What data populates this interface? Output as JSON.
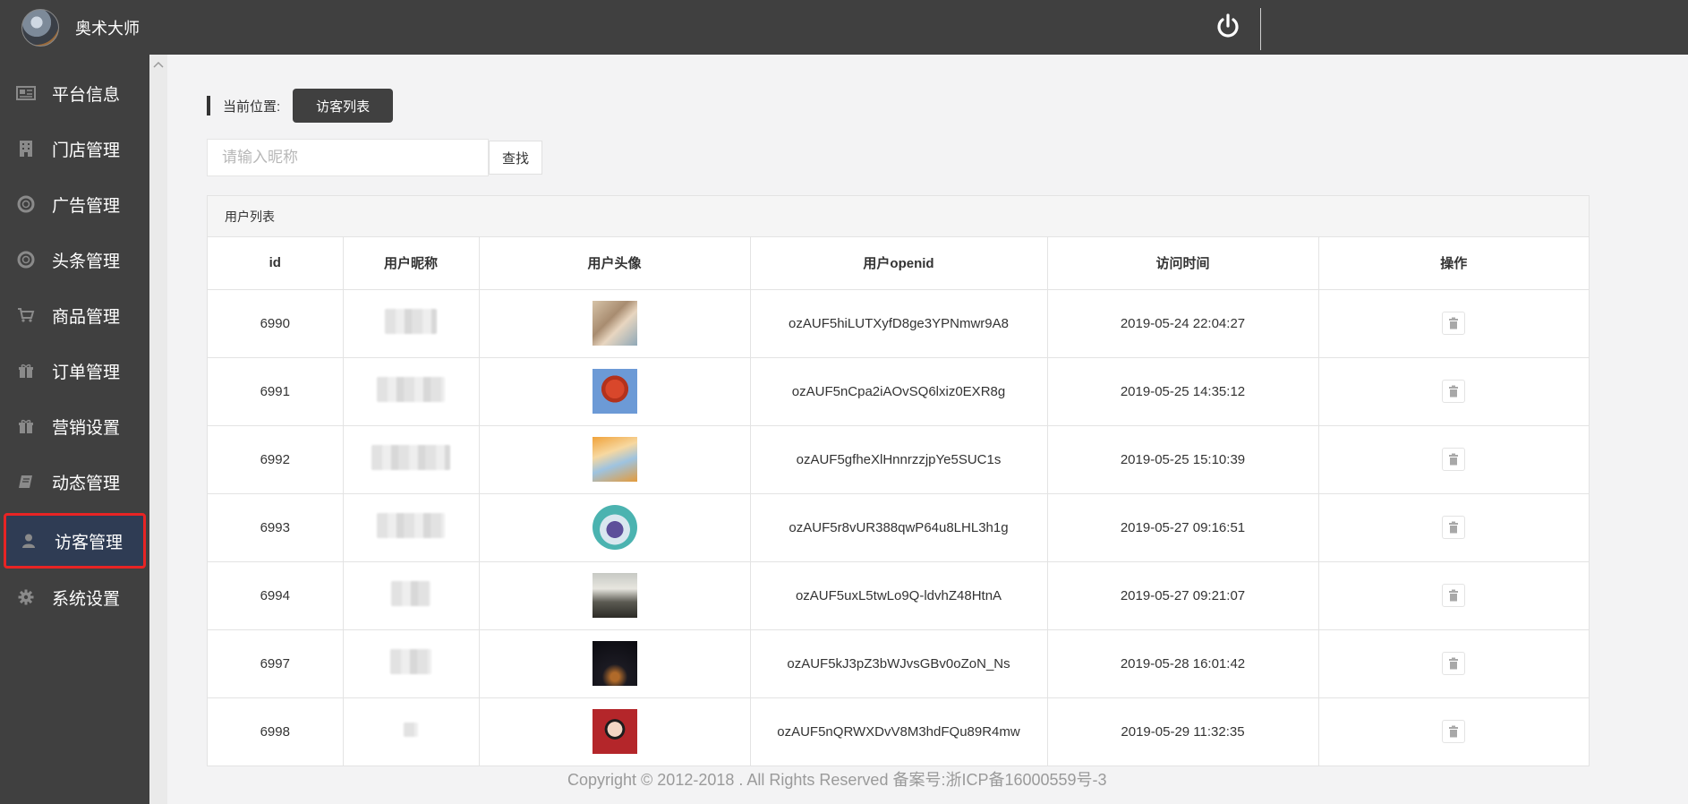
{
  "header": {
    "brand_name": "奥术大师",
    "icons": {
      "avatar": "user-avatar",
      "power": "power-icon"
    }
  },
  "sidebar": {
    "items": [
      {
        "label": "平台信息",
        "icon": "newspaper-icon"
      },
      {
        "label": "门店管理",
        "icon": "building-icon"
      },
      {
        "label": "广告管理",
        "icon": "lifebuoy-icon"
      },
      {
        "label": "头条管理",
        "icon": "lifebuoy-icon"
      },
      {
        "label": "商品管理",
        "icon": "cart-icon"
      },
      {
        "label": "订单管理",
        "icon": "gift-icon"
      },
      {
        "label": "营销设置",
        "icon": "gift-icon"
      },
      {
        "label": "动态管理",
        "icon": "book-icon"
      },
      {
        "label": "访客管理",
        "icon": "user-icon",
        "active": true
      },
      {
        "label": "系统设置",
        "icon": "gear-icon"
      }
    ]
  },
  "breadcrumb": {
    "label": "当前位置:",
    "current": "访客列表"
  },
  "search": {
    "placeholder": "请输入昵称",
    "value": "",
    "button": "查找"
  },
  "panel": {
    "title": "用户列表",
    "columns": [
      "id",
      "用户昵称",
      "用户头像",
      "用户openid",
      "访问时间",
      "操作"
    ],
    "rows": [
      {
        "id": "6990",
        "openid": "ozAUF5hiLUTXyfD8ge3YPNmwr9A8",
        "time": "2019-05-24 22:04:27"
      },
      {
        "id": "6991",
        "openid": "ozAUF5nCpa2iAOvSQ6lxiz0EXR8g",
        "time": "2019-05-25 14:35:12"
      },
      {
        "id": "6992",
        "openid": "ozAUF5gfheXlHnnrzzjpYe5SUC1s",
        "time": "2019-05-25 15:10:39"
      },
      {
        "id": "6993",
        "openid": "ozAUF5r8vUR388qwP64u8LHL3h1g",
        "time": "2019-05-27 09:16:51"
      },
      {
        "id": "6994",
        "openid": "ozAUF5uxL5twLo9Q-ldvhZ48HtnA",
        "time": "2019-05-27 09:21:07"
      },
      {
        "id": "6997",
        "openid": "ozAUF5kJ3pZ3bWJvsGBv0oZoN_Ns",
        "time": "2019-05-28 16:01:42"
      },
      {
        "id": "6998",
        "openid": "ozAUF5nQRWXDvV8M3hdFQu89R4mw",
        "time": "2019-05-29 11:32:35"
      }
    ],
    "action_icon": "trash-icon"
  },
  "footer": {
    "text": "Copyright © 2012-2018 . All Rights Reserved 备案号:浙ICP备16000559号-3"
  }
}
